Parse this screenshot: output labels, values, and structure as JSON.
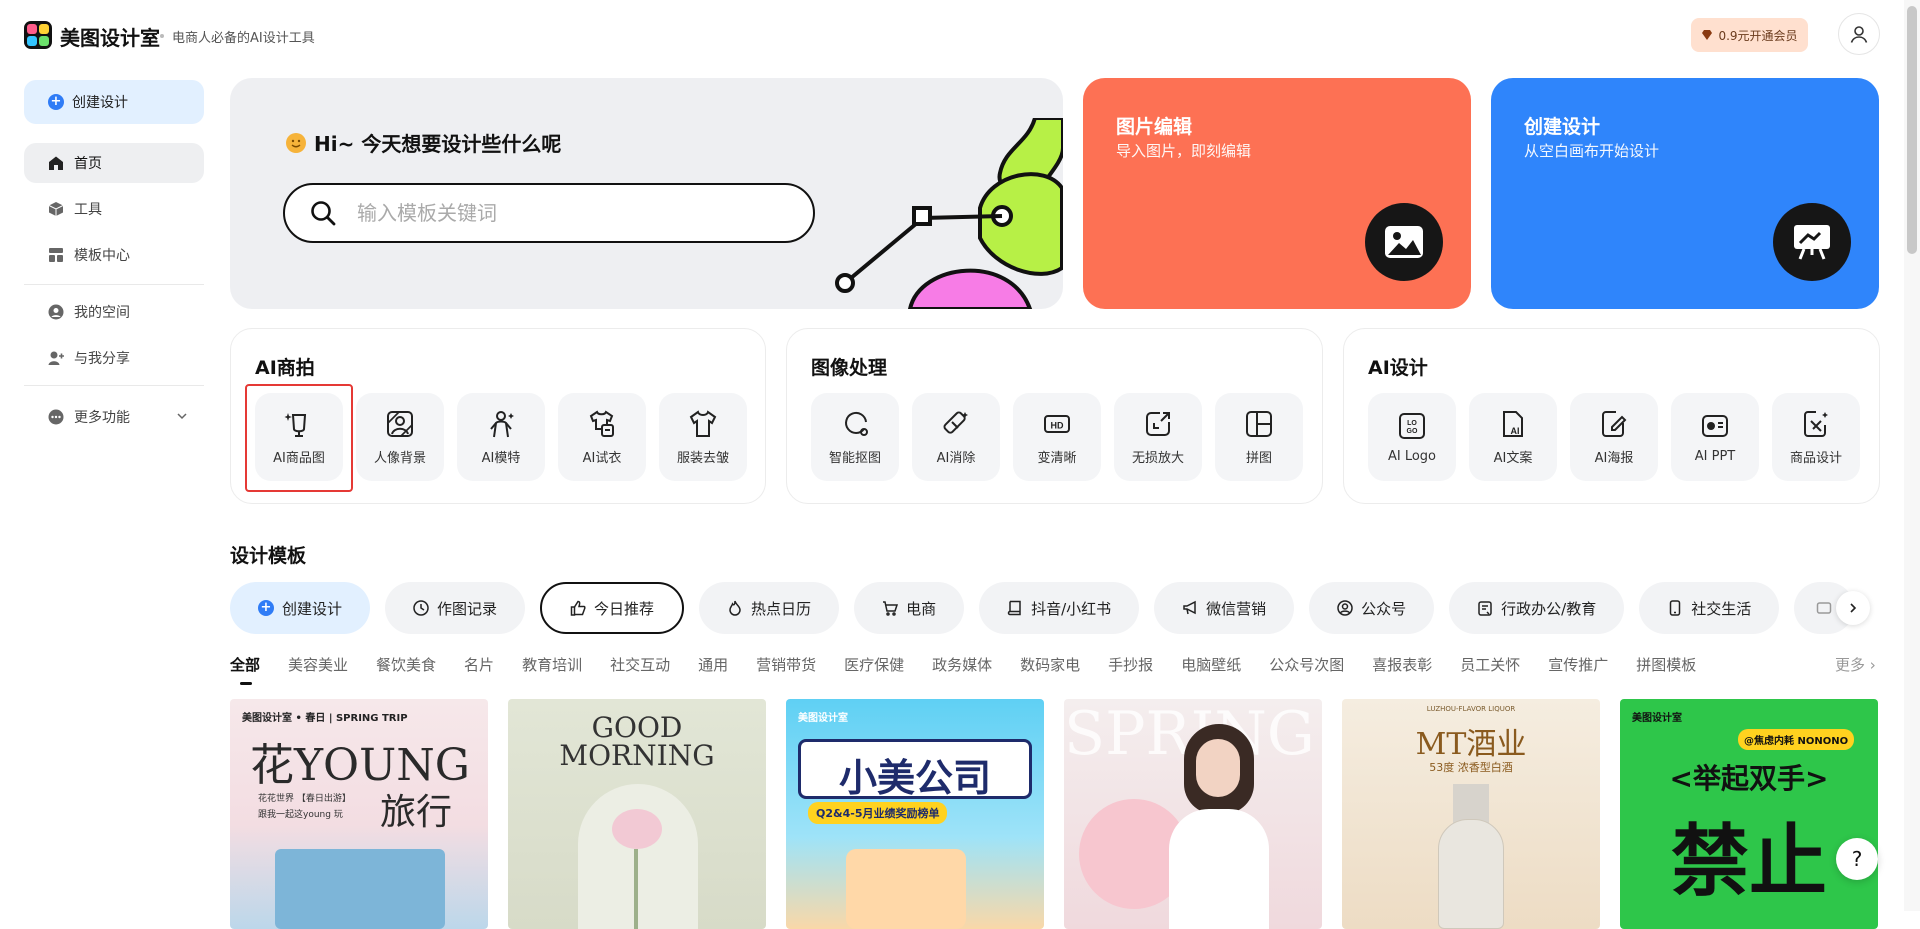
{
  "header": {
    "brand": "美图设计室",
    "tagline": "电商人必备的AI设计工具",
    "vip_label": "0.9元开通会员"
  },
  "sidebar": {
    "create_label": "创建设计",
    "items": [
      {
        "label": "首页",
        "icon": "home-icon",
        "active": true
      },
      {
        "label": "工具",
        "icon": "box-icon"
      },
      {
        "label": "模板中心",
        "icon": "template-icon"
      },
      {
        "label": "我的空间",
        "icon": "user-circle-icon"
      },
      {
        "label": "与我分享",
        "icon": "share-user-icon"
      },
      {
        "label": "更多功能",
        "icon": "more-icon"
      }
    ]
  },
  "hero": {
    "greeting": "Hi~ 今天想要设计些什么呢",
    "search_placeholder": "输入模板关键词"
  },
  "cards": {
    "edit": {
      "title": "图片编辑",
      "subtitle": "导入图片，即刻编辑",
      "color": "#fd7154"
    },
    "create": {
      "title": "创建设计",
      "subtitle": "从空白画布开始设计",
      "color": "#2f85fb"
    }
  },
  "groups": [
    {
      "title": "AI商拍",
      "tools": [
        {
          "label": "AI商品图",
          "icon": "product-photo-icon"
        },
        {
          "label": "人像背景",
          "icon": "portrait-bg-icon"
        },
        {
          "label": "AI模特",
          "icon": "model-icon"
        },
        {
          "label": "AI试衣",
          "icon": "try-on-icon"
        },
        {
          "label": "服装去皱",
          "icon": "shirt-icon"
        }
      ]
    },
    {
      "title": "图像处理",
      "tools": [
        {
          "label": "智能抠图",
          "icon": "cutout-icon"
        },
        {
          "label": "AI消除",
          "icon": "eraser-icon"
        },
        {
          "label": "变清晰",
          "icon": "hd-icon"
        },
        {
          "label": "无损放大",
          "icon": "upscale-icon"
        },
        {
          "label": "拼图",
          "icon": "collage-icon"
        }
      ]
    },
    {
      "title": "AI设计",
      "tools": [
        {
          "label": "AI Logo",
          "icon": "logo-icon"
        },
        {
          "label": "AI文案",
          "icon": "copywriting-icon"
        },
        {
          "label": "AI海报",
          "icon": "poster-icon"
        },
        {
          "label": "AI PPT",
          "icon": "ppt-icon"
        },
        {
          "label": "商品设计",
          "icon": "product-design-icon"
        }
      ]
    }
  ],
  "templates": {
    "title": "设计模板",
    "chips": [
      {
        "label": "创建设计",
        "icon": "plus-icon"
      },
      {
        "label": "作图记录",
        "icon": "clock-icon"
      },
      {
        "label": "今日推荐",
        "icon": "thumbs-up-icon"
      },
      {
        "label": "热点日历",
        "icon": "flame-icon"
      },
      {
        "label": "电商",
        "icon": "cart-icon"
      },
      {
        "label": "抖音/小红书",
        "icon": "book-icon"
      },
      {
        "label": "微信营销",
        "icon": "megaphone-icon"
      },
      {
        "label": "公众号",
        "icon": "account-icon"
      },
      {
        "label": "行政办公/教育",
        "icon": "clipboard-icon"
      },
      {
        "label": "社交生活",
        "icon": "phone-icon"
      }
    ],
    "categories": [
      "全部",
      "美容美业",
      "餐饮美食",
      "名片",
      "教育培训",
      "社交互动",
      "通用",
      "营销带货",
      "医疗保健",
      "政务媒体",
      "数码家电",
      "手抄报",
      "电脑壁纸",
      "公众号次图",
      "喜报表彰",
      "员工关怀",
      "宣传推广",
      "拼图模板"
    ],
    "more_label": "更多",
    "thumbnails": [
      {
        "logo": "美图设计室 • 春日 | SPRING TRIP",
        "headline": "花YOUNG",
        "headline2": "旅行",
        "line1": "花花世界 【春日出游】",
        "line2": "跟我一起这young 玩"
      },
      {
        "headline": "GOOD",
        "headline2": "MORNING"
      },
      {
        "logo": "美图设计室",
        "headline": "小美公司",
        "line1": "Q2&4-5月业绩奖励榜单"
      },
      {
        "headline": "SPRING"
      },
      {
        "headline": "MT酒业",
        "line1": "LUZHOU-FLAVOR LIQUOR",
        "line2": "53度 浓香型白酒"
      },
      {
        "logo": "美图设计室",
        "badge": "@焦虑内耗 NONONO",
        "headline": "<举起双手>",
        "headline2": "禁止"
      }
    ]
  },
  "help_label": "?"
}
